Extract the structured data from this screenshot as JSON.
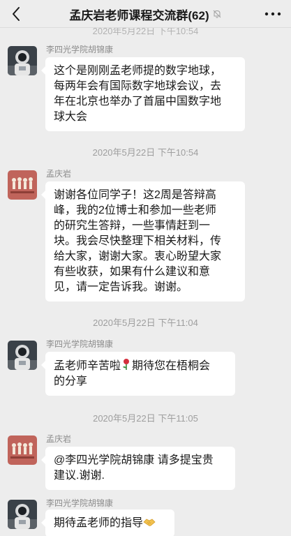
{
  "header": {
    "title": "孟庆岩老师课程交流群(62)",
    "back_icon": "chevron-left-icon",
    "mute_icon": "bell-off-icon",
    "more_icon": "more-dots-icon"
  },
  "ghost_timestamp": "2020年5月22日 下午10:54",
  "messages": [
    {
      "sender": "李四光学院胡锦康",
      "avatar": "astronaut-avatar",
      "lines": [
        "这个是刚刚孟老师提的数字地球，",
        "每两年会有国际数字地球会议，去",
        "年在北京也举办了首届中国数字地",
        "球大会"
      ]
    },
    {
      "timestamp": "2020年5月22日 下午10:54",
      "sender": "孟庆岩",
      "avatar": "figures-avatar",
      "lines": [
        "谢谢各位同学子！这2周是答辩高",
        "峰，我的2位博士和参加一些老师",
        "的研究生答辩，一些事情赶到一",
        "块。我会尽快整理下相关材料，传",
        "给大家，谢谢大家。衷心盼望大家",
        "有些收获，如果有什么建议和意",
        "见，请一定告诉我。谢谢。"
      ]
    },
    {
      "timestamp": "2020年5月22日 下午11:04",
      "sender": "李四光学院胡锦康",
      "avatar": "astronaut-avatar",
      "lines": [
        "孟老师辛苦啦",
        "的分享"
      ],
      "inline_after_first": "期待您在梧桐会",
      "emoji": "rose-icon"
    },
    {
      "timestamp": "2020年5月22日 下午11:05",
      "sender": "孟庆岩",
      "avatar": "figures-avatar",
      "lines": [
        "@李四光学院胡锦康 请多提宝贵",
        "建议.谢谢."
      ]
    },
    {
      "sender": "李四光学院胡锦康",
      "avatar": "astronaut-avatar",
      "lines": [
        "期待孟老师的指导"
      ],
      "emoji": "handshake-icon"
    }
  ]
}
